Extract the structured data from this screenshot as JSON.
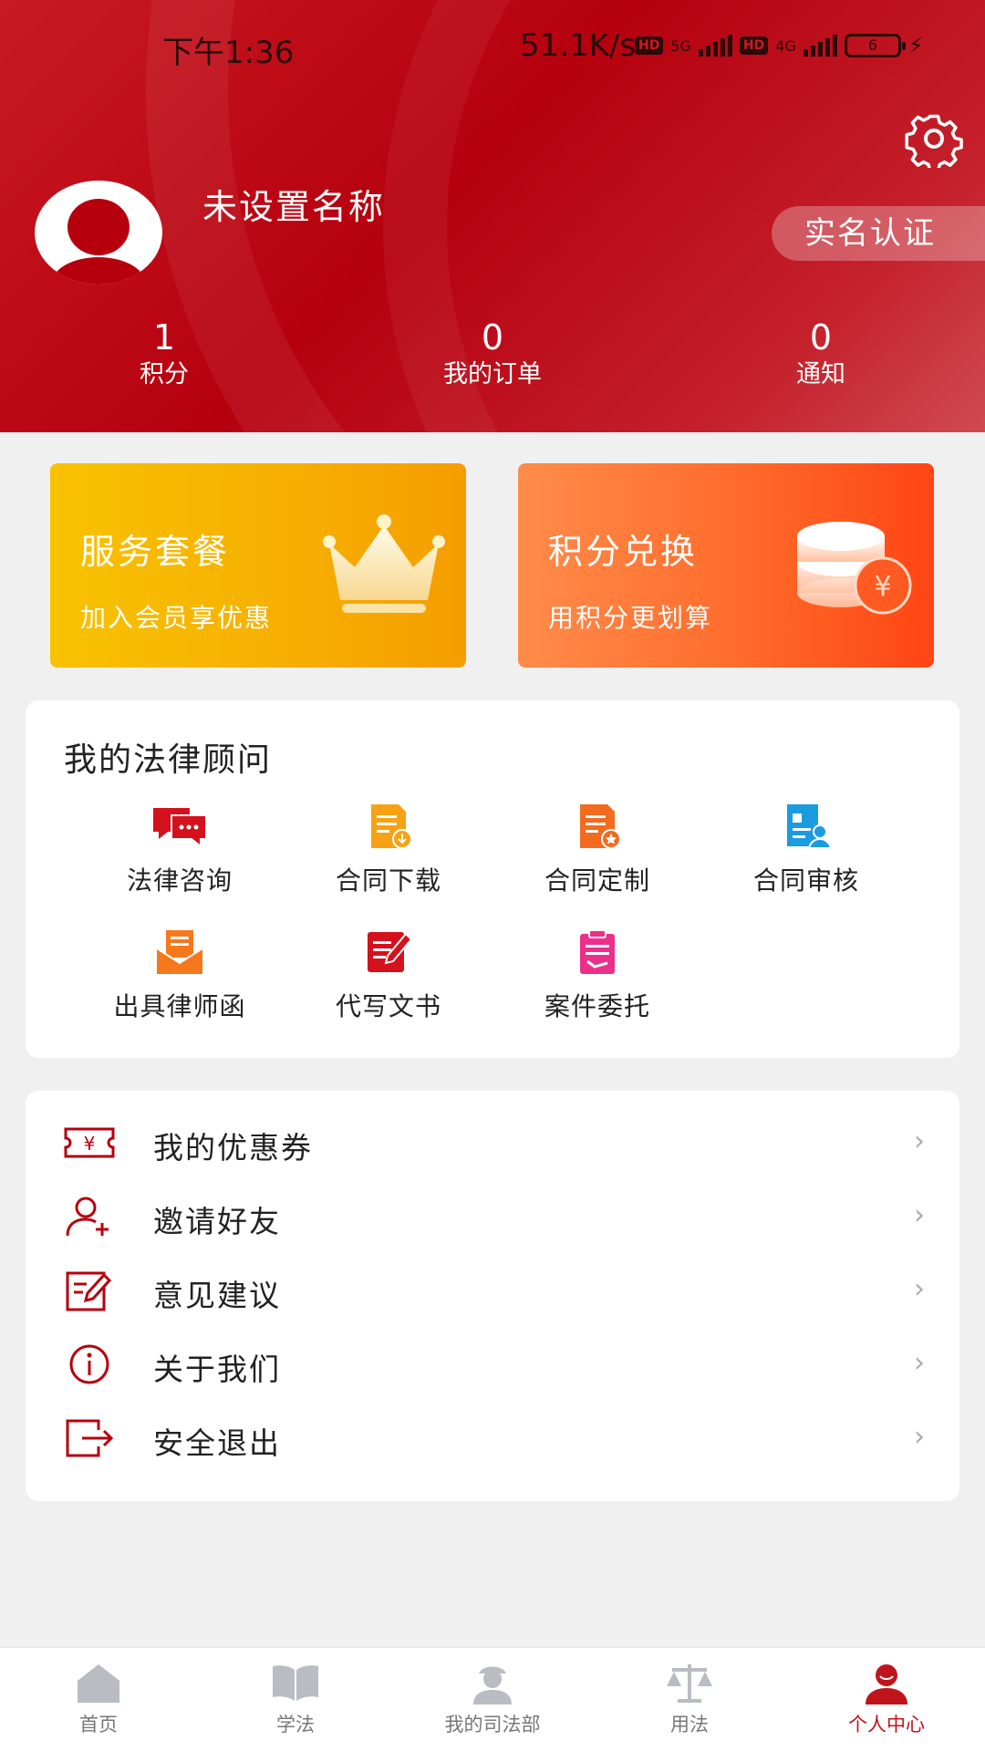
{
  "status_bar": {
    "time": "下午1:36",
    "network_speed": "51.1K/s",
    "hd_badge": "HD",
    "signal1": "5G",
    "signal2": "4G",
    "battery": "6"
  },
  "header": {
    "user_name": "未设置名称",
    "verify_button": "实名认证",
    "stats": [
      {
        "value": "1",
        "label": "积分"
      },
      {
        "value": "0",
        "label": "我的订单"
      },
      {
        "value": "0",
        "label": "通知"
      }
    ]
  },
  "promos": [
    {
      "title": "服务套餐",
      "subtitle": "加入会员享优惠",
      "icon": "crown-icon"
    },
    {
      "title": "积分兑换",
      "subtitle": "用积分更划算",
      "icon": "coins-icon"
    }
  ],
  "advisor": {
    "title": "我的法律顾问",
    "services": [
      {
        "label": "法律咨询",
        "icon": "chat-icon",
        "color": "#d4111c"
      },
      {
        "label": "合同下载",
        "icon": "download-doc-icon",
        "color": "#f6a214"
      },
      {
        "label": "合同定制",
        "icon": "custom-doc-icon",
        "color": "#f26b1f"
      },
      {
        "label": "合同审核",
        "icon": "review-doc-icon",
        "color": "#1b9be0"
      },
      {
        "label": "出具律师函",
        "icon": "letter-icon",
        "color": "#f5781d"
      },
      {
        "label": "代写文书",
        "icon": "write-icon",
        "color": "#d4111c"
      },
      {
        "label": "案件委托",
        "icon": "clipboard-icon",
        "color": "#ec2f8a"
      }
    ]
  },
  "menu": [
    {
      "label": "我的优惠券",
      "icon": "coupon-icon"
    },
    {
      "label": "邀请好友",
      "icon": "add-user-icon"
    },
    {
      "label": "意见建议",
      "icon": "feedback-icon"
    },
    {
      "label": "关于我们",
      "icon": "info-icon"
    },
    {
      "label": "安全退出",
      "icon": "logout-icon"
    }
  ],
  "tabs": [
    {
      "label": "首页",
      "icon": "home-icon"
    },
    {
      "label": "学法",
      "icon": "book-icon"
    },
    {
      "label": "我的司法部",
      "icon": "officer-icon"
    },
    {
      "label": "用法",
      "icon": "scales-icon"
    },
    {
      "label": "个人中心",
      "icon": "person-icon",
      "active": true
    }
  ],
  "colors": {
    "brand_red": "#b6000e",
    "active_tab": "#c0141c",
    "gold": "#f6b000",
    "orange": "#ff6a2a"
  }
}
